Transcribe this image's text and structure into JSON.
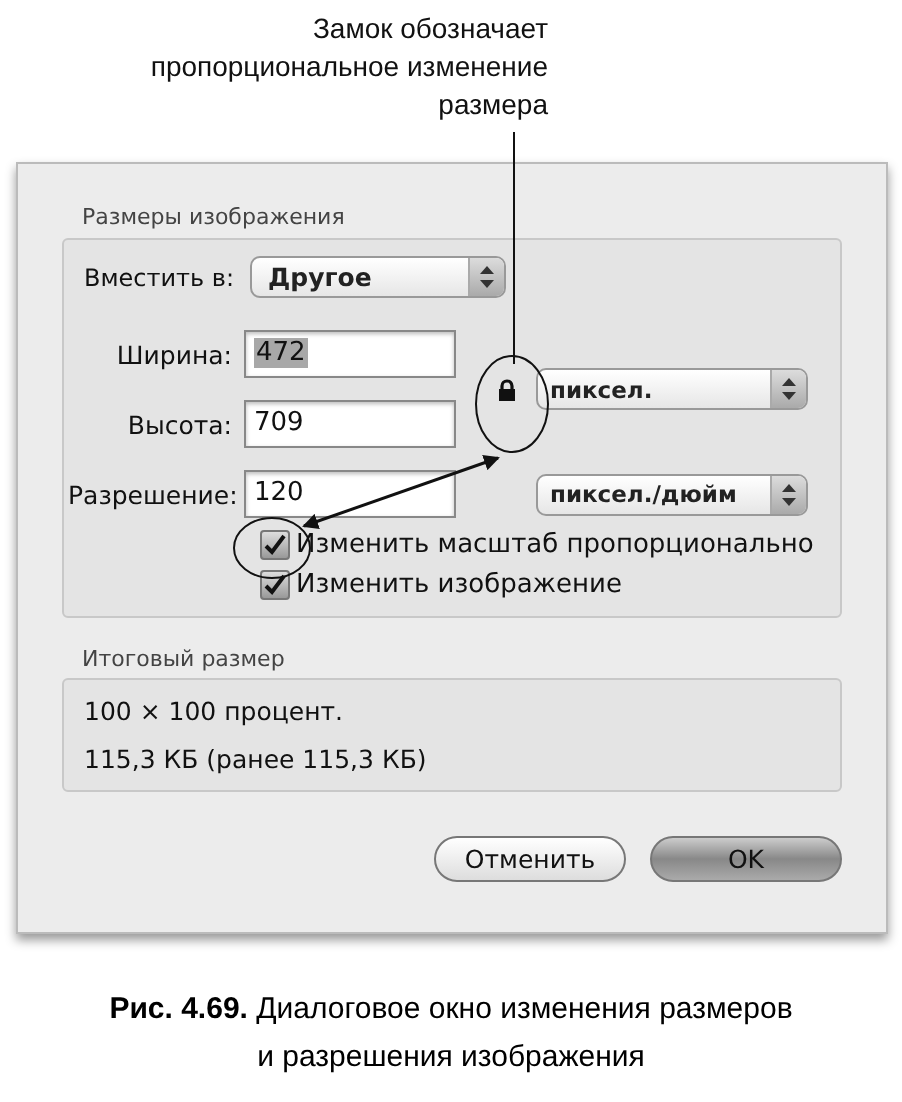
{
  "callout": {
    "lines": [
      "Замок обозначает",
      "пропорциональное изменение",
      "размера"
    ]
  },
  "dialog": {
    "image_size": {
      "title": "Размеры изображения",
      "fit": {
        "label": "Вместить в:",
        "value": "Другое"
      },
      "fields": [
        {
          "label": "Ширина:",
          "value": "472",
          "text_selected": true
        },
        {
          "label": "Высота:",
          "value": "709",
          "text_selected": false
        },
        {
          "label": "Разрешение:",
          "value": "120",
          "text_selected": false
        }
      ],
      "units": [
        "пиксел.",
        "пиксел./дюйм"
      ],
      "lock_shown": true,
      "checkboxes": [
        {
          "label": "Изменить масштаб пропорционально",
          "checked": true
        },
        {
          "label": "Изменить изображение",
          "checked": true
        }
      ]
    },
    "result": {
      "title": "Итоговый размер",
      "lines": [
        "100 × 100 процент.",
        "115,3 КБ (ранее 115,3 КБ)"
      ]
    },
    "buttons": [
      {
        "label": "Отменить",
        "default": false
      },
      {
        "label": "OK",
        "default": true
      }
    ]
  },
  "caption": [
    "**Рис. 4.69.** Диалоговое окно изменения размеров",
    "и разрешения изображения"
  ]
}
